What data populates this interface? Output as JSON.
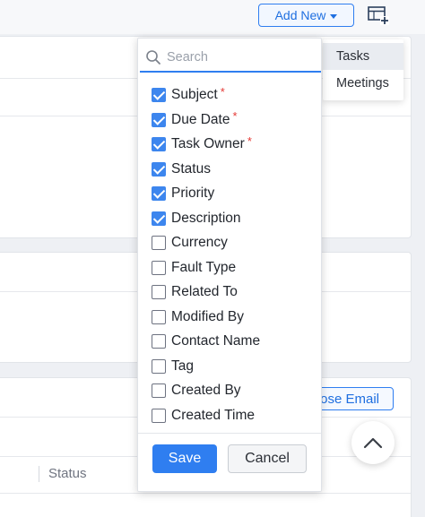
{
  "toolbar": {
    "add_new_label": "Add New",
    "add_panel_icon": "table-add-icon"
  },
  "modules_menu": {
    "items": [
      {
        "label": "Tasks",
        "active": true
      },
      {
        "label": "Meetings",
        "active": false
      }
    ]
  },
  "field_picker": {
    "search_placeholder": "Search",
    "fields": [
      {
        "label": "Subject",
        "checked": true,
        "required": true
      },
      {
        "label": "Due Date",
        "checked": true,
        "required": true
      },
      {
        "label": "Task Owner",
        "checked": true,
        "required": true
      },
      {
        "label": "Status",
        "checked": true,
        "required": false
      },
      {
        "label": "Priority",
        "checked": true,
        "required": false
      },
      {
        "label": "Description",
        "checked": true,
        "required": false
      },
      {
        "label": "Currency",
        "checked": false,
        "required": false
      },
      {
        "label": "Fault Type",
        "checked": false,
        "required": false
      },
      {
        "label": "Related To",
        "checked": false,
        "required": false
      },
      {
        "label": "Modified By",
        "checked": false,
        "required": false
      },
      {
        "label": "Contact Name",
        "checked": false,
        "required": false
      },
      {
        "label": "Tag",
        "checked": false,
        "required": false
      },
      {
        "label": "Created By",
        "checked": false,
        "required": false
      },
      {
        "label": "Created Time",
        "checked": false,
        "required": false
      }
    ],
    "required_mark": "*",
    "save_label": "Save",
    "cancel_label": "Cancel"
  },
  "background": {
    "compose_email_label": "pose Email",
    "table_status_header": "Status"
  },
  "colors": {
    "accent": "#2f7ef0",
    "checkbox_checked": "#3d86ee",
    "required": "#e53935"
  }
}
